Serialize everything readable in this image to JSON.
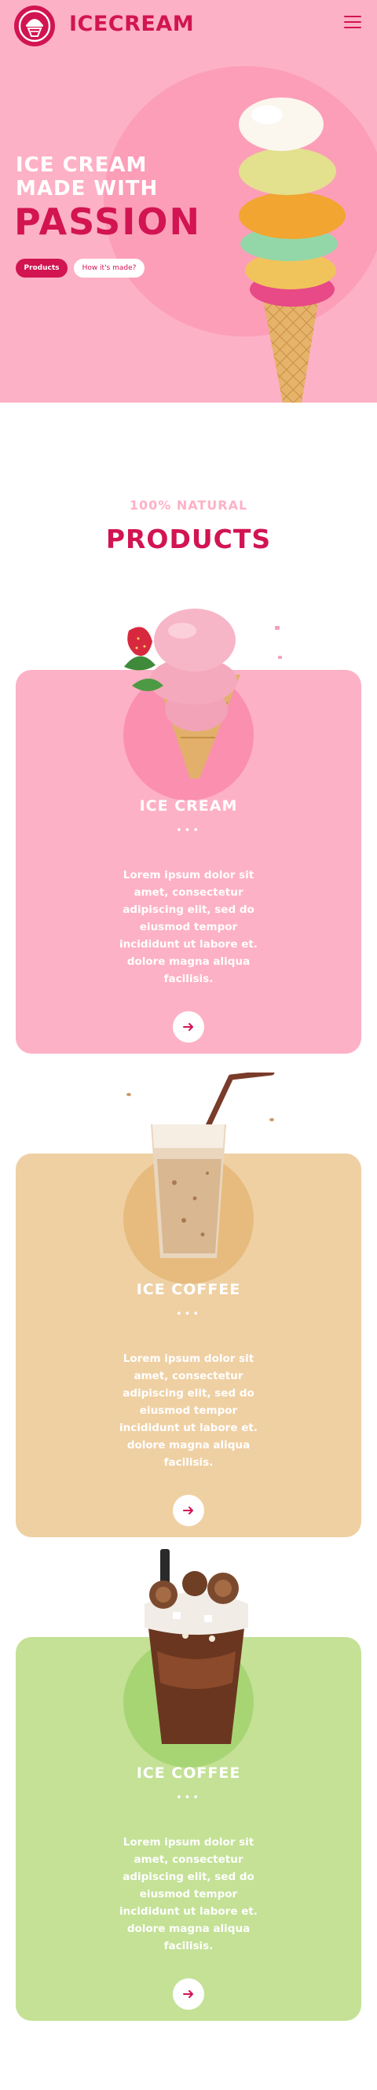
{
  "header": {
    "brand": "ICECREAM",
    "logo_icon": "ice-cream-logo-icon",
    "menu_icon": "hamburger-menu-icon"
  },
  "hero": {
    "line1": "ICE CREAM",
    "line2": "MADE WITH",
    "line3": "PASSION",
    "primary_button": "Products",
    "secondary_button": "How it's made?",
    "image_icon": "ice-cream-cone-illustration"
  },
  "products": {
    "eyebrow": "100% NATURAL",
    "title": "PRODUCTS",
    "items": [
      {
        "title": "ICE CREAM",
        "dots": "•••",
        "description": "Lorem ipsum dolor sit amet, consectetur adipiscing elit, sed do eiusmod tempor incididunt ut labore et. dolore magna aliqua facilisis.",
        "button_icon": "arrow-right-icon",
        "image_icon": "strawberry-ice-cream-cone-illustration"
      },
      {
        "title": "ICE COFFEE",
        "dots": "•••",
        "description": "Lorem ipsum dolor sit amet, consectetur adipiscing elit, sed do eiusmod tempor incididunt ut labore et. dolore magna aliqua facilisis.",
        "button_icon": "arrow-right-icon",
        "image_icon": "iced-coffee-glass-illustration"
      },
      {
        "title": "ICE COFFEE",
        "dots": "•••",
        "description": "Lorem ipsum dolor sit amet, consectetur adipiscing elit, sed do eiusmod tempor incididunt ut labore et. dolore magna aliqua facilisis.",
        "button_icon": "arrow-right-icon",
        "image_icon": "chocolate-milkshake-illustration"
      }
    ]
  },
  "colors": {
    "primary": "#d21452",
    "hero_bg": "#fdb1c6",
    "card_pink": "#fdb1c6",
    "card_tan": "#efd0a3",
    "card_green": "#c4e196"
  }
}
